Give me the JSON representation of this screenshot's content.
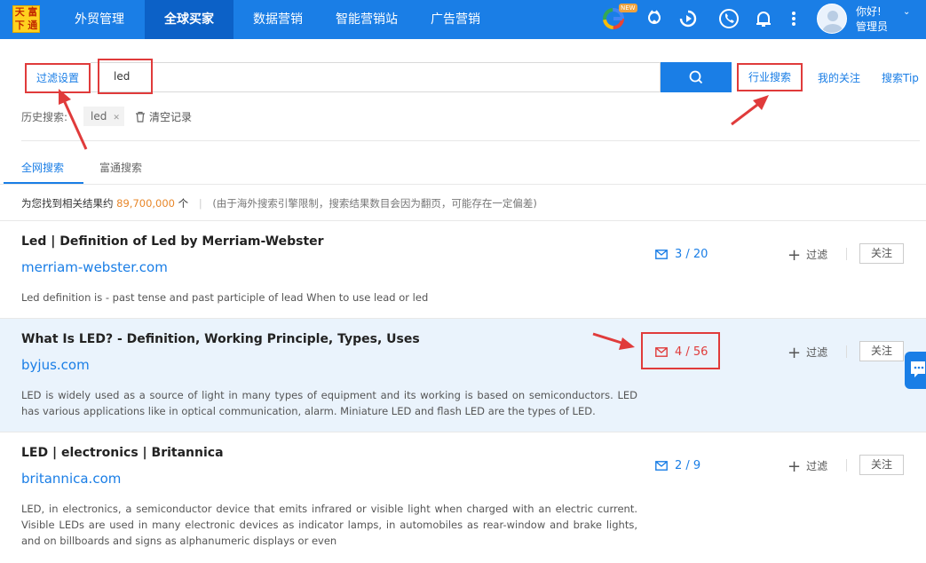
{
  "logo": {
    "chars": [
      "天",
      "富",
      "下",
      "通"
    ]
  },
  "nav": {
    "items": [
      {
        "label": "外贸管理"
      },
      {
        "label": "全球买家"
      },
      {
        "label": "数据营销"
      },
      {
        "label": "智能营销站"
      },
      {
        "label": "广告营销"
      }
    ],
    "active_index": 1,
    "new_badge": "NEW",
    "icons": [
      "google-icon",
      "badge-icon",
      "play-icon",
      "phone-icon",
      "bell-icon",
      "more-icon"
    ],
    "user": {
      "greeting": "你好!",
      "role": "管理员"
    }
  },
  "search": {
    "filter_label": "过滤设置",
    "query": "led",
    "industry_label": "行业搜索",
    "my_follow_label": "我的关注",
    "tip_label": "搜索Tip",
    "history_label": "历史搜索:",
    "history_items": [
      "led"
    ],
    "clear_label": "清空记录"
  },
  "tabs": [
    {
      "label": "全网搜索",
      "active": true
    },
    {
      "label": "富通搜索",
      "active": false
    }
  ],
  "summary": {
    "prefix": "为您找到相关结果约",
    "count": "89,700,000",
    "suffix": "个",
    "note": "(由于海外搜索引擎限制，搜索结果数目会因为翻页，可能存在一定偏差)"
  },
  "results": [
    {
      "title": "Led | Definition of Led by Merriam-Webster",
      "domain": "merriam-webster.com",
      "description": "Led definition is - past tense and past participle of lead When to use lead or led",
      "mail": "3 / 20",
      "filter_label": "过滤",
      "follow_label": "关注"
    },
    {
      "title": "What Is LED? - Definition, Working Principle, Types, Uses",
      "domain": "byjus.com",
      "description": "LED is widely used as a source of light in many types of equipment and its working is based on semiconductors. LED has various applications like in optical communication, alarm. Miniature LED and flash LED are the types of LED.",
      "mail": "4 / 56",
      "filter_label": "过滤",
      "follow_label": "关注"
    },
    {
      "title": "LED | electronics | Britannica",
      "domain": "britannica.com",
      "description": "LED, in electronics, a semiconductor device that emits infrared or visible light when charged with an electric current. Visible LEDs are used in many electronic devices as indicator lamps, in automobiles as rear-window and brake lights, and on billboards and signs as alphanumeric displays or even",
      "mail": "2 / 9",
      "filter_label": "过滤",
      "follow_label": "关注"
    }
  ],
  "colors": {
    "primary": "#1a7ee6",
    "highlight": "#e03b3b",
    "count": "#e8872a"
  }
}
